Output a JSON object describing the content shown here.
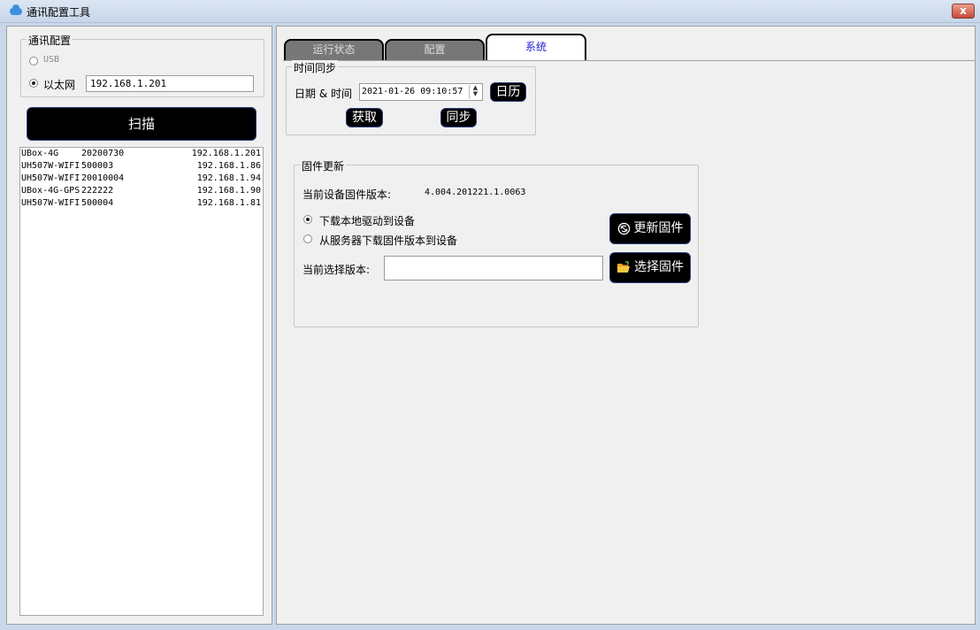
{
  "window": {
    "title": "通讯配置工具",
    "close_label": "x"
  },
  "comm": {
    "group_label": "通讯配置",
    "usb_label": "USB",
    "ethernet_label": "以太网",
    "ip_value": "192.168.1.201",
    "selected": "ethernet"
  },
  "scan_button": "扫描",
  "devices": [
    {
      "name": "UBox-4G",
      "serial": "20200730",
      "ip": "192.168.1.201"
    },
    {
      "name": "UH507W-WIFI",
      "serial": "500003",
      "ip": "192.168.1.86"
    },
    {
      "name": "UH507W-WIFI",
      "serial": "20010004",
      "ip": "192.168.1.94"
    },
    {
      "name": "UBox-4G-GPS",
      "serial": "222222",
      "ip": "192.168.1.90"
    },
    {
      "name": "UH507W-WIFI",
      "serial": "500004",
      "ip": "192.168.1.81"
    }
  ],
  "tabs": [
    {
      "label": "运行状态",
      "active": false
    },
    {
      "label": "配置",
      "active": false
    },
    {
      "label": "系统",
      "active": true
    }
  ],
  "time_sync": {
    "group_label": "时间同步",
    "datetime_label": "日期 & 时间",
    "datetime_value": "2021-01-26 09:10:57",
    "calendar_button": "日历",
    "get_button": "获取",
    "sync_button": "同步"
  },
  "firmware": {
    "group_label": "固件更新",
    "current_version_label": "当前设备固件版本:",
    "current_version_value": "4.004.201221.1.0063",
    "option_local": "下载本地驱动到设备",
    "option_server": "从服务器下载固件版本到设备",
    "selected_option": "local",
    "selected_version_label": "当前选择版本:",
    "selected_version_value": "",
    "update_button": "更新固件",
    "select_button": "选择固件"
  },
  "icons": {
    "app": "cloud-icon",
    "update": "refresh-circle-icon",
    "select": "folder-open-icon"
  },
  "colors": {
    "button_bg": "#000000",
    "button_border": "#2a3a7a",
    "active_tab_text": "#2020d0"
  }
}
